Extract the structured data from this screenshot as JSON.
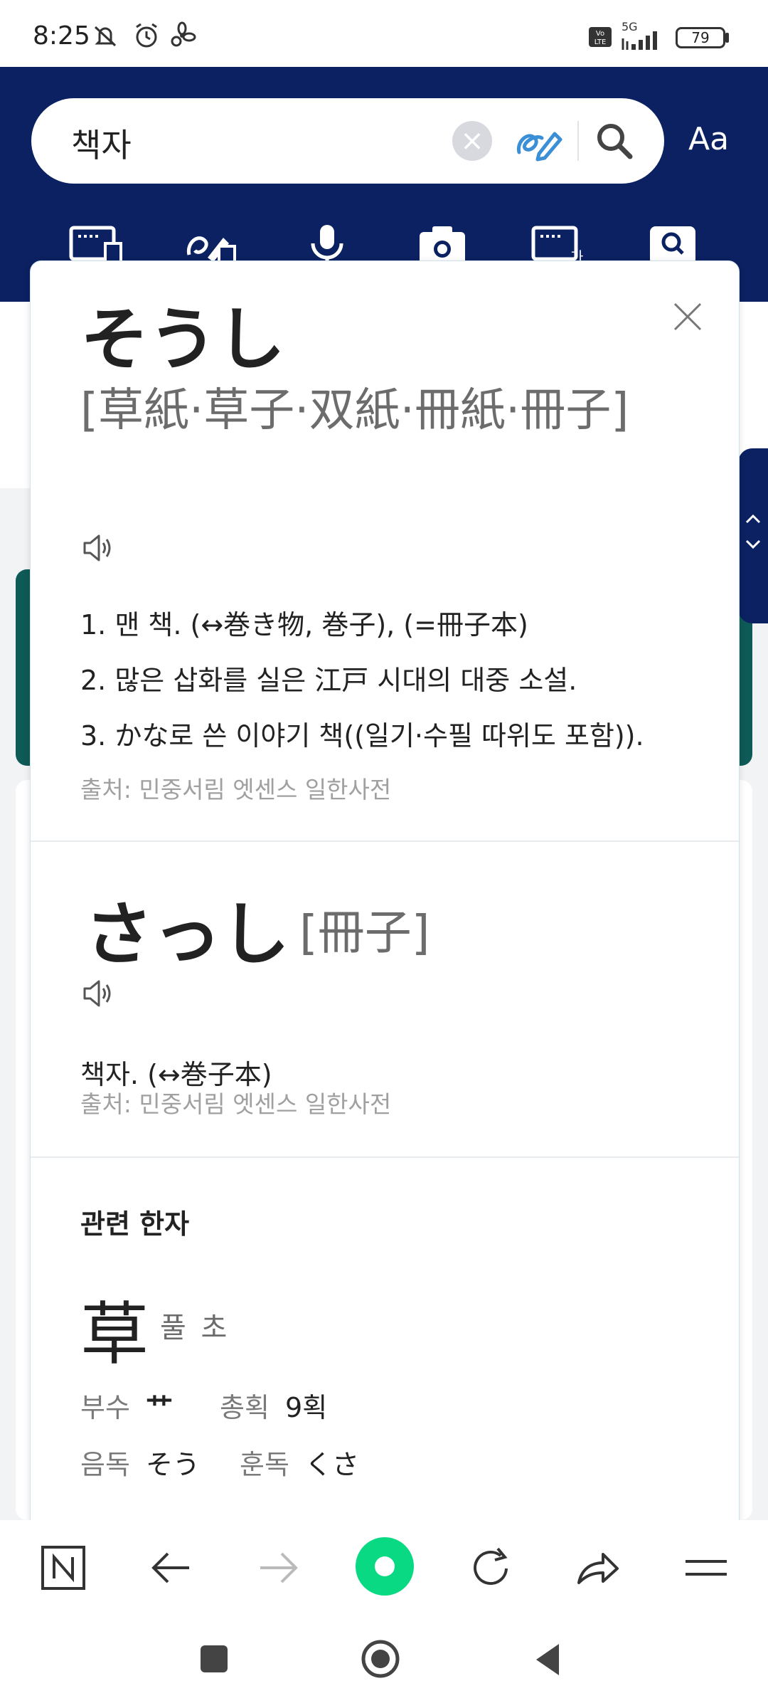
{
  "status_bar": {
    "time": "8:25",
    "battery": "79",
    "network": "5G"
  },
  "search": {
    "query": "책자",
    "font_button": "Aa"
  },
  "entries": [
    {
      "word": "そうし",
      "hanja": "[草紙·草子·双紙·冊紙·冊子]",
      "definitions": [
        "1. 맨 책. (↔巻き物, 巻子), (=冊子本)",
        "2. 많은 삽화를 실은 江戸 시대의 대중 소설.",
        "3. かな로 쓴 이야기 책((일기·수필 따위도 포함))."
      ],
      "source": "출처: 민중서림 엣센스 일한사전"
    },
    {
      "word": "さっし",
      "hanja": "[冊子]",
      "definitions": [
        "책자. (↔巻子本)"
      ],
      "source": "출처: 민중서림 엣센스 일한사전"
    }
  ],
  "related": {
    "title": "관련 한자",
    "char": "草",
    "meaning": "풀 초",
    "radical_label": "부수",
    "radical": "艹",
    "strokes_label": "총획",
    "strokes": "9획",
    "on_label": "음독",
    "on": "そう",
    "kun_label": "훈독",
    "kun": "くさ"
  },
  "icons": {
    "tools": [
      "keyboard-icon",
      "handwriting-icon",
      "microphone-icon",
      "camera-icon",
      "korean-keyboard-icon",
      "book-search-icon"
    ],
    "nav": [
      "naver-icon",
      "back-icon",
      "forward-icon",
      "green-dot-icon",
      "refresh-icon",
      "share-icon",
      "menu-icon"
    ]
  },
  "colors": {
    "header": "#0b2161",
    "accent_green": "#08d982",
    "teal": "#0e5a56"
  }
}
